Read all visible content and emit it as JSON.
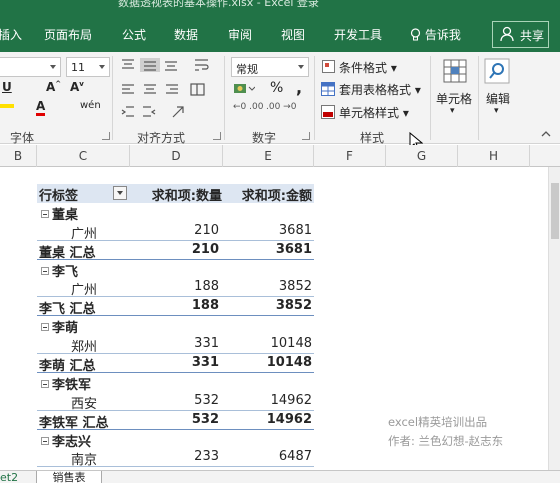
{
  "window": {
    "title": "数据透视表的基本操作.xlsx - Excel  登录"
  },
  "ribbon_tabs": [
    {
      "label": "插入"
    },
    {
      "label": "页面布局"
    },
    {
      "label": "公式"
    },
    {
      "label": "数据"
    },
    {
      "label": "审阅"
    },
    {
      "label": "视图"
    },
    {
      "label": "开发工具"
    },
    {
      "label": "告诉我"
    }
  ],
  "share_label": "共享",
  "ribbon": {
    "font_size": "11",
    "number_format": "常规",
    "conditional_format": "条件格式",
    "table_format": "套用表格格式",
    "cell_style": "单元格样式",
    "cells": "单元格",
    "editing": "编辑",
    "percent": "%",
    "comma": ",",
    "groups": {
      "font": "字体",
      "alignment": "对齐方式",
      "number": "数字",
      "styles": "样式"
    }
  },
  "columns": [
    "B",
    "C",
    "D",
    "E",
    "F",
    "G",
    "H"
  ],
  "pivot": {
    "headers": [
      "行标签",
      "求和项:数量",
      "求和项:金额"
    ],
    "rows": [
      {
        "type": "group",
        "label": "董桌"
      },
      {
        "type": "detail",
        "label": "广州",
        "qty": "210",
        "amt": "3681"
      },
      {
        "type": "total",
        "label": "董桌 汇总",
        "qty": "210",
        "amt": "3681"
      },
      {
        "type": "group",
        "label": "李飞"
      },
      {
        "type": "detail",
        "label": "广州",
        "qty": "188",
        "amt": "3852"
      },
      {
        "type": "total",
        "label": "李飞 汇总",
        "qty": "188",
        "amt": "3852"
      },
      {
        "type": "group",
        "label": "李萌"
      },
      {
        "type": "detail",
        "label": "郑州",
        "qty": "331",
        "amt": "10148"
      },
      {
        "type": "total",
        "label": "李萌 汇总",
        "qty": "331",
        "amt": "10148"
      },
      {
        "type": "group",
        "label": "李铁军"
      },
      {
        "type": "detail",
        "label": "西安",
        "qty": "532",
        "amt": "14962"
      },
      {
        "type": "total",
        "label": "李铁军 汇总",
        "qty": "532",
        "amt": "14962"
      },
      {
        "type": "group",
        "label": "李志兴"
      },
      {
        "type": "detail",
        "label": "南京",
        "qty": "233",
        "amt": "6487"
      }
    ]
  },
  "watermark": {
    "line1": "excel精英培训出品",
    "line2": "作者: 兰色幻想-赵志东"
  },
  "sheet_tab": "销售表",
  "sheet_edge": "et2",
  "colors": {
    "brand": "#217346",
    "pivot_header": "#dde6f2"
  }
}
